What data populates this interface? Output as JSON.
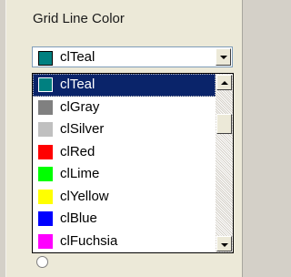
{
  "group": {
    "title": "Grid Line Color"
  },
  "combo": {
    "value": "clTeal",
    "swatch_color": "#008080"
  },
  "dropdown": {
    "selected_index": 0,
    "items": [
      {
        "label": "clTeal",
        "color": "#008080"
      },
      {
        "label": "clGray",
        "color": "#808080"
      },
      {
        "label": "clSilver",
        "color": "#c0c0c0"
      },
      {
        "label": "clRed",
        "color": "#ff0000"
      },
      {
        "label": "clLime",
        "color": "#00ff00"
      },
      {
        "label": "clYellow",
        "color": "#ffff00"
      },
      {
        "label": "clBlue",
        "color": "#0000ff"
      },
      {
        "label": "clFuchsia",
        "color": "#ff00ff"
      }
    ]
  },
  "colors": {
    "selection": "#0a246a",
    "panel": "#ece9d8"
  }
}
